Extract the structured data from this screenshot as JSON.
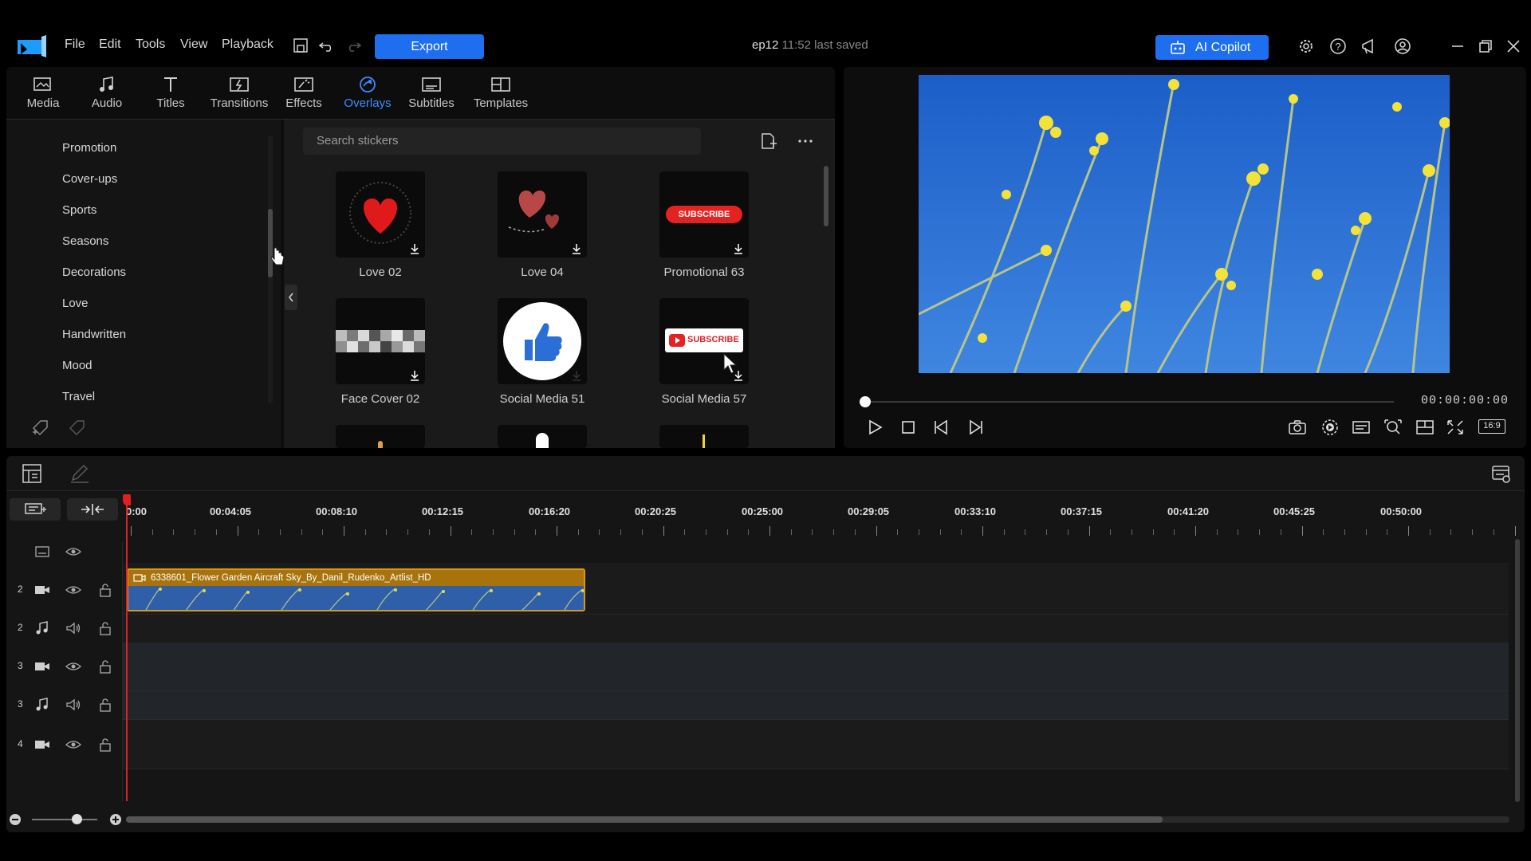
{
  "menu": {
    "file": "File",
    "edit": "Edit",
    "tools": "Tools",
    "view": "View",
    "playback": "Playback"
  },
  "toolbar": {
    "export_label": "Export"
  },
  "project": {
    "name": "ep12",
    "saved": "11:52 last saved"
  },
  "copilot": {
    "label": "AI Copilot"
  },
  "library_tabs": [
    {
      "label": "Media",
      "icon": "media-icon"
    },
    {
      "label": "Audio",
      "icon": "music-note-icon"
    },
    {
      "label": "Titles",
      "icon": "text-t-icon"
    },
    {
      "label": "Transitions",
      "icon": "transition-icon"
    },
    {
      "label": "Effects",
      "icon": "effects-icon"
    },
    {
      "label": "Overlays",
      "icon": "overlay-icon",
      "active": true
    },
    {
      "label": "Subtitles",
      "icon": "subtitles-icon"
    },
    {
      "label": "Templates",
      "icon": "templates-icon"
    }
  ],
  "categories": [
    "Promotion",
    "Cover-ups",
    "Sports",
    "Seasons",
    "Decorations",
    "Love",
    "Handwritten",
    "Mood",
    "Travel"
  ],
  "search": {
    "placeholder": "Search stickers"
  },
  "stickers": [
    {
      "label": "Love 02"
    },
    {
      "label": "Love 04"
    },
    {
      "label": "Promotional 63",
      "badge_text": "SUBSCRIBE"
    },
    {
      "label": "Face Cover 02"
    },
    {
      "label": "Social Media 51"
    },
    {
      "label": "Social Media 57",
      "badge_text": "SUBSCRIBE"
    }
  ],
  "preview": {
    "timecode": "00:00:00:00",
    "aspect": "16:9",
    "progress": 0
  },
  "timeline": {
    "ruler": [
      "0:00",
      "00:04:05",
      "00:08:10",
      "00:12:15",
      "00:16:20",
      "00:20:25",
      "00:25:00",
      "00:29:05",
      "00:33:10",
      "00:37:15",
      "00:41:20",
      "00:45:25",
      "00:50:00"
    ],
    "tracks": [
      {
        "num": "2",
        "kind": "video"
      },
      {
        "num": "2",
        "kind": "audio"
      },
      {
        "num": "3",
        "kind": "video"
      },
      {
        "num": "3",
        "kind": "audio"
      },
      {
        "num": "4",
        "kind": "video"
      }
    ],
    "clip": {
      "name": "6338601_Flower Garden Aircraft Sky_By_Danil_Rudenko_Artlist_HD"
    }
  },
  "colors": {
    "accent": "#1e6ff0",
    "active_tab": "#3c8dff",
    "playhead": "#e02020",
    "clip_header": "#a8730d"
  }
}
